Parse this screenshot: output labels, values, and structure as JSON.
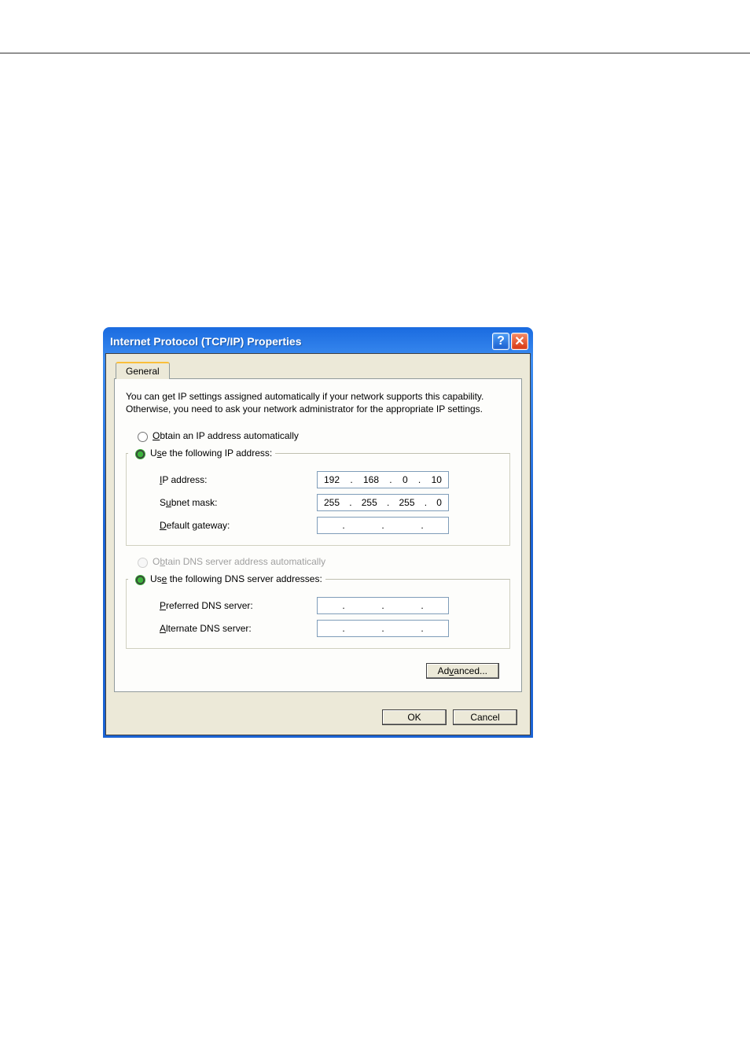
{
  "titlebar": {
    "title": "Internet Protocol (TCP/IP) Properties"
  },
  "tab": {
    "label": "General"
  },
  "description": "You can get IP settings assigned automatically if your network supports this capability. Otherwise, you need to ask your network administrator for the appropriate IP settings.",
  "ip_section": {
    "radio_auto": "Obtain an IP address automatically",
    "radio_auto_u": "O",
    "radio_manual": "Use the following IP address:",
    "radio_manual_u": "s",
    "fields": {
      "ip_label": "IP address:",
      "ip_u": "I",
      "ip_value": [
        "192",
        "168",
        "0",
        "10"
      ],
      "subnet_label": "Subnet mask:",
      "subnet_u": "u",
      "subnet_value": [
        "255",
        "255",
        "255",
        "0"
      ],
      "gateway_label": "Default gateway:",
      "gateway_u": "D",
      "gateway_value": [
        "",
        "",
        "",
        ""
      ]
    }
  },
  "dns_section": {
    "radio_auto": "Obtain DNS server address automatically",
    "radio_auto_u": "b",
    "radio_manual": "Use the following DNS server addresses:",
    "radio_manual_u": "e",
    "fields": {
      "preferred_label": "Preferred DNS server:",
      "preferred_u": "P",
      "preferred_value": [
        "",
        "",
        "",
        ""
      ],
      "alternate_label": "Alternate DNS server:",
      "alternate_u": "A",
      "alternate_value": [
        "",
        "",
        "",
        ""
      ]
    }
  },
  "buttons": {
    "advanced": "Advanced...",
    "advanced_u": "v",
    "ok": "OK",
    "cancel": "Cancel"
  }
}
